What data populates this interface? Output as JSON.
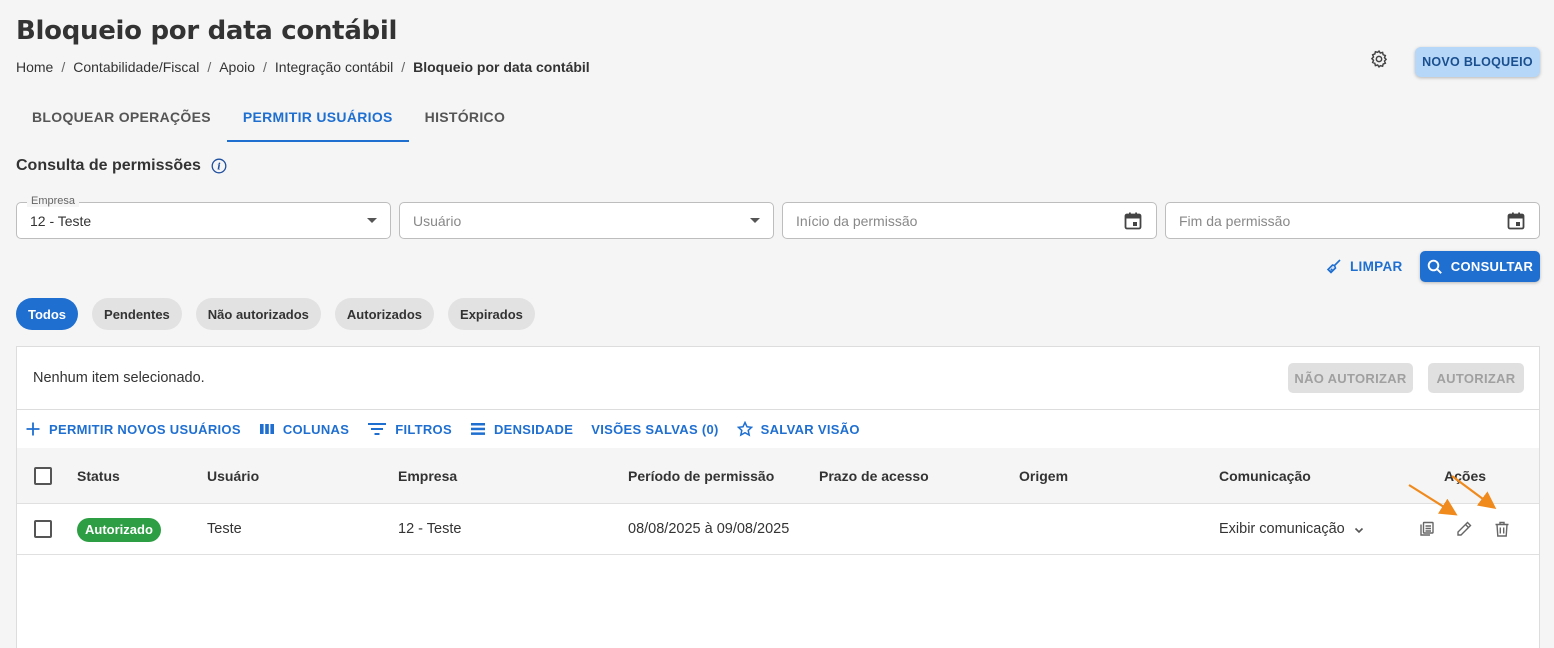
{
  "header": {
    "title": "Bloqueio por data contábil",
    "breadcrumb": [
      "Home",
      "Contabilidade/Fiscal",
      "Apoio",
      "Integração contábil",
      "Bloqueio por data contábil"
    ],
    "new_button": "NOVO BLOQUEIO"
  },
  "tabs": [
    {
      "label": "BLOQUEAR OPERAÇÕES",
      "active": false
    },
    {
      "label": "PERMITIR USUÁRIOS",
      "active": true
    },
    {
      "label": "HISTÓRICO",
      "active": false
    }
  ],
  "section": {
    "title": "Consulta de permissões"
  },
  "filters": {
    "empresa": {
      "label": "Empresa",
      "value": "12 - Teste"
    },
    "usuario": {
      "placeholder": "Usuário"
    },
    "inicio": {
      "placeholder": "Início da permissão"
    },
    "fim": {
      "placeholder": "Fim da permissão"
    },
    "clear_label": "LIMPAR",
    "search_label": "CONSULTAR"
  },
  "chips": [
    {
      "label": "Todos",
      "active": true
    },
    {
      "label": "Pendentes",
      "active": false
    },
    {
      "label": "Não autorizados",
      "active": false
    },
    {
      "label": "Autorizados",
      "active": false
    },
    {
      "label": "Expirados",
      "active": false
    }
  ],
  "selection": {
    "text": "Nenhum item selecionado.",
    "reject_label": "NÃO AUTORIZAR",
    "approve_label": "AUTORIZAR"
  },
  "toolbar": {
    "add": "PERMITIR NOVOS USUÁRIOS",
    "columns": "COLUNAS",
    "filters": "FILTROS",
    "density": "DENSIDADE",
    "saved_views": "VISÕES SALVAS (0)",
    "save_view": "SALVAR VISÃO"
  },
  "table": {
    "headers": {
      "status": "Status",
      "usuario": "Usuário",
      "empresa": "Empresa",
      "periodo": "Período de permissão",
      "prazo": "Prazo de acesso",
      "origem": "Origem",
      "comunicacao": "Comunicação",
      "acoes": "Ações"
    },
    "rows": [
      {
        "status": "Autorizado",
        "usuario": "Teste",
        "empresa": "12 - Teste",
        "periodo": "08/08/2025 à 09/08/2025",
        "prazo": "",
        "origem": "",
        "comunicacao": "Exibir comunicação"
      }
    ]
  },
  "colors": {
    "primary": "#1f6fd1",
    "success": "#2e9e45",
    "annotation": "#f08a1c"
  }
}
